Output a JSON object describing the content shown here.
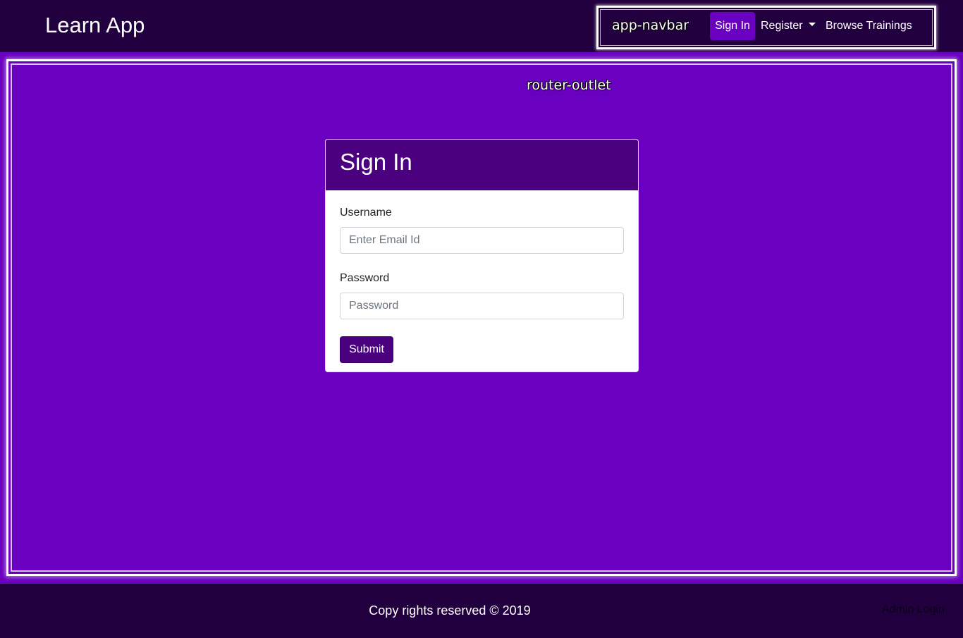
{
  "app": {
    "title": "Learn App"
  },
  "navbar": {
    "debug_label": "app-navbar",
    "items": [
      {
        "label": "Sign In",
        "active": true
      },
      {
        "label": "Register",
        "has_dropdown": true
      },
      {
        "label": "Browse Trainings"
      }
    ]
  },
  "outlet": {
    "debug_label": "router-outlet"
  },
  "signin_card": {
    "title": "Sign In",
    "username_label": "Username",
    "username_placeholder": "Enter Email Id",
    "password_label": "Password",
    "password_placeholder": "Password",
    "submit_label": "Submit"
  },
  "footer": {
    "copyright": "Copy rights reserved © 2019",
    "admin_link": "Admin Login"
  },
  "colors": {
    "header_bg": "#22003f",
    "page_bg": "#6a00c0",
    "card_header_bg": "#4a007f",
    "button_bg": "#4a007f"
  }
}
